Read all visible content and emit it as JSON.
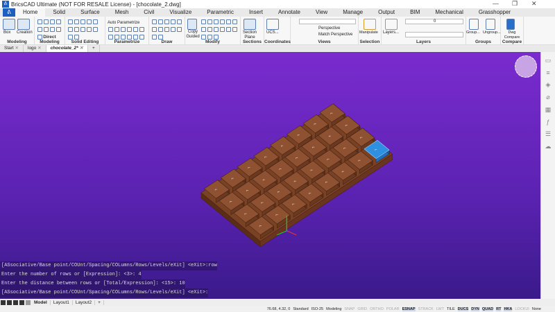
{
  "window": {
    "title": "BricsCAD Ultimate (NOT FOR RESALE License) - [chocolate_2.dwg]",
    "minimize": "—",
    "restore": "❐",
    "close": "✕"
  },
  "ribbon_tabs": [
    "Home",
    "Solid",
    "Surface",
    "Mesh",
    "Civil",
    "Visualize",
    "Parametric",
    "Insert",
    "Annotate",
    "View",
    "Manage",
    "Output",
    "BIM",
    "Mechanical",
    "Grasshopper"
  ],
  "panels": {
    "modeling": {
      "label": "Modeling",
      "box": "Box",
      "creation": "Creation"
    },
    "direct_modeling": {
      "label": "Direct Modeling"
    },
    "solid_editing": {
      "label": "Solid Editing"
    },
    "parametrize": {
      "label": "Parametrize",
      "auto": "Auto Parametrize"
    },
    "draw": {
      "label": "Draw"
    },
    "modify": {
      "label": "Modify",
      "copy_guided": "Copy Guided"
    },
    "sections": {
      "label": "Sections",
      "section_plane": "Section Plane"
    },
    "coordinates": {
      "label": "Coordinates",
      "ucs": "UCS..."
    },
    "views": {
      "label": "Views",
      "perspective": "Perspective",
      "match_perspective": "Match Perspective"
    },
    "selection": {
      "label": "Selection",
      "manipulate": "Manipulate"
    },
    "layers": {
      "label": "Layers",
      "layers": "Layers...",
      "current_layer": "0"
    },
    "groups": {
      "label": "Groups",
      "group": "Group...",
      "ungroup": "Ungroup..."
    },
    "compare": {
      "label": "Compare",
      "dwg_compare": "Dwg Compare"
    }
  },
  "doc_tabs": [
    {
      "label": "Start"
    },
    {
      "label": "logo"
    },
    {
      "label": "chocolate_2*",
      "active": true
    }
  ],
  "command_lines": [
    "[ASsociative/Base point/COUnt/Spacing/COLumns/Rows/Levels/eXit] <eXit>:row",
    "Enter the number of rows or [Expression]: <3>: 4",
    "Enter the distance between rows or [Total/Expression]: <15>: 10",
    "[ASsociative/Base point/COUnt/Spacing/COLumns/Rows/Levels/eXit] <eXit>:"
  ],
  "layout_tabs": [
    "Model",
    "Layout1",
    "Layout2",
    "+"
  ],
  "status": {
    "coords": "76.68, 4.32, 0",
    "items": [
      {
        "t": "Standard",
        "s": "n"
      },
      {
        "t": "ISO-25",
        "s": "n"
      },
      {
        "t": "Modeling",
        "s": "n"
      },
      {
        "t": "SNAP",
        "s": "off"
      },
      {
        "t": "GRID",
        "s": "off"
      },
      {
        "t": "ORTHO",
        "s": "off"
      },
      {
        "t": "POLAR",
        "s": "off"
      },
      {
        "t": "ESNAP",
        "s": "on"
      },
      {
        "t": "STRACK",
        "s": "off"
      },
      {
        "t": "LWT",
        "s": "off"
      },
      {
        "t": "TILE",
        "s": "n"
      },
      {
        "t": "DUCS",
        "s": "on"
      },
      {
        "t": "DYN",
        "s": "on"
      },
      {
        "t": "QUAD",
        "s": "on"
      },
      {
        "t": "RT",
        "s": "on"
      },
      {
        "t": "HKA",
        "s": "on"
      },
      {
        "t": "LOCKUI",
        "s": "off"
      },
      {
        "t": "None",
        "s": "n"
      }
    ]
  },
  "colors": {
    "viewport_top": "#7a2bcf",
    "chocolate": "#7a4225",
    "chocolate_top": "#8e5232",
    "selected": "#2f8fe0"
  },
  "chocolate": {
    "columns": 8,
    "rows": 4
  }
}
